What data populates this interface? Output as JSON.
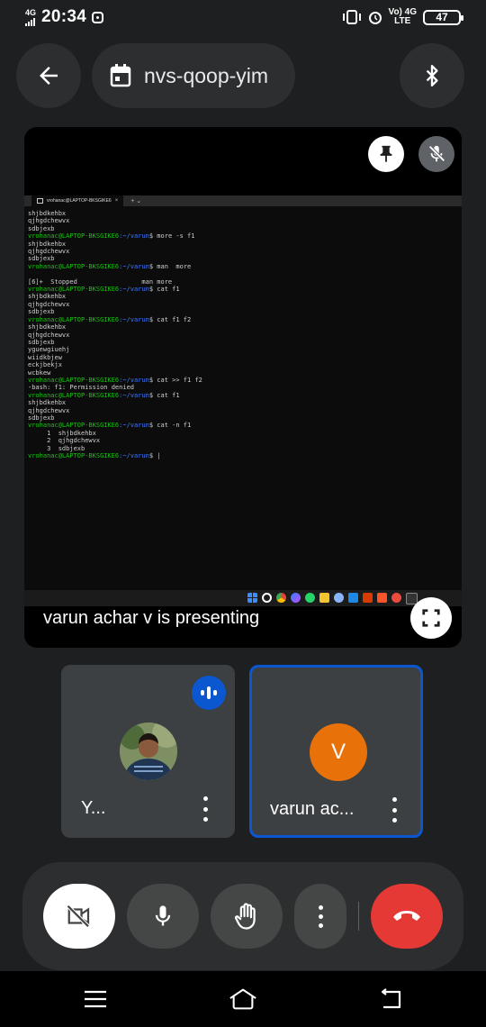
{
  "status_bar": {
    "network": "4G",
    "time": "20:34",
    "volte": "Vo) 4G",
    "lte": "LTE",
    "battery": "47"
  },
  "header": {
    "meeting_code": "nvs-qoop-yim",
    "back_icon": "arrow-left-icon",
    "calendar_icon": "calendar-icon",
    "bluetooth_icon": "bluetooth-icon"
  },
  "presentation": {
    "terminal_tab": "vrohanac@LAPTOP-BKSGIKE6",
    "terminal_tab_close": "×",
    "terminal_tab_new": "+  ⌄",
    "user_host": "vrohanac@LAPTOP-BKSGIKE6",
    "path": ":~/varun",
    "lines": [
      {
        "kind": "out",
        "text": "shjbdkehbx"
      },
      {
        "kind": "out",
        "text": "qjhgdchewvx"
      },
      {
        "kind": "out",
        "text": "sdbjexb"
      },
      {
        "kind": "prompt",
        "cmd": "$ more -s f1"
      },
      {
        "kind": "out",
        "text": "shjbdkehbx"
      },
      {
        "kind": "out",
        "text": "qjhgdchewvx"
      },
      {
        "kind": "out",
        "text": "sdbjexb"
      },
      {
        "kind": "prompt",
        "cmd": "$ man  more"
      },
      {
        "kind": "out",
        "text": " "
      },
      {
        "kind": "out",
        "text": "[6]+  Stopped                 man more"
      },
      {
        "kind": "prompt",
        "cmd": "$ cat f1"
      },
      {
        "kind": "out",
        "text": "shjbdkehbx"
      },
      {
        "kind": "out",
        "text": "qjhgdchewvx"
      },
      {
        "kind": "out",
        "text": "sdbjexb"
      },
      {
        "kind": "prompt",
        "cmd": "$ cat f1 f2"
      },
      {
        "kind": "out",
        "text": "shjbdkehbx"
      },
      {
        "kind": "out",
        "text": "qjhgdchewvx"
      },
      {
        "kind": "out",
        "text": "sdbjexb"
      },
      {
        "kind": "out",
        "text": "yguewgiuehj"
      },
      {
        "kind": "out",
        "text": "wiidkbjew"
      },
      {
        "kind": "out",
        "text": "eckjbekjx"
      },
      {
        "kind": "out",
        "text": "wcbkew"
      },
      {
        "kind": "prompt",
        "cmd": "$ cat >> f1 f2"
      },
      {
        "kind": "out",
        "text": "-bash: f1: Permission denied"
      },
      {
        "kind": "prompt",
        "cmd": "$ cat f1"
      },
      {
        "kind": "out",
        "text": "shjbdkehbx"
      },
      {
        "kind": "out",
        "text": "qjhgdchewvx"
      },
      {
        "kind": "out",
        "text": "sdbjexb"
      },
      {
        "kind": "prompt",
        "cmd": "$ cat -n f1"
      },
      {
        "kind": "out",
        "text": "     1  shjbdkehbx"
      },
      {
        "kind": "out",
        "text": "     2  qjhgdchewvx"
      },
      {
        "kind": "out",
        "text": "     3  sdbjexb"
      },
      {
        "kind": "prompt",
        "cmd": "$ |"
      }
    ],
    "caption": "varun achar v is presenting",
    "pin_icon": "pin-icon",
    "mic_off_icon": "mic-off-icon",
    "fullscreen_icon": "fullscreen-icon"
  },
  "participants": [
    {
      "name": "Y...",
      "avatar": "photo",
      "speaking": true
    },
    {
      "name": "varun ac...",
      "initial": "V",
      "avatar_color": "#e8710a",
      "active": true
    }
  ],
  "controls": {
    "camera_icon": "camera-off-icon",
    "mic_icon": "mic-icon",
    "hand_icon": "raise-hand-icon",
    "more_icon": "more-vert-icon",
    "end_icon": "end-call-icon",
    "end_color": "#e53935"
  },
  "colors": {
    "accent": "#0b57d0",
    "background": "#1e1f20",
    "surface": "#2d2e30"
  }
}
